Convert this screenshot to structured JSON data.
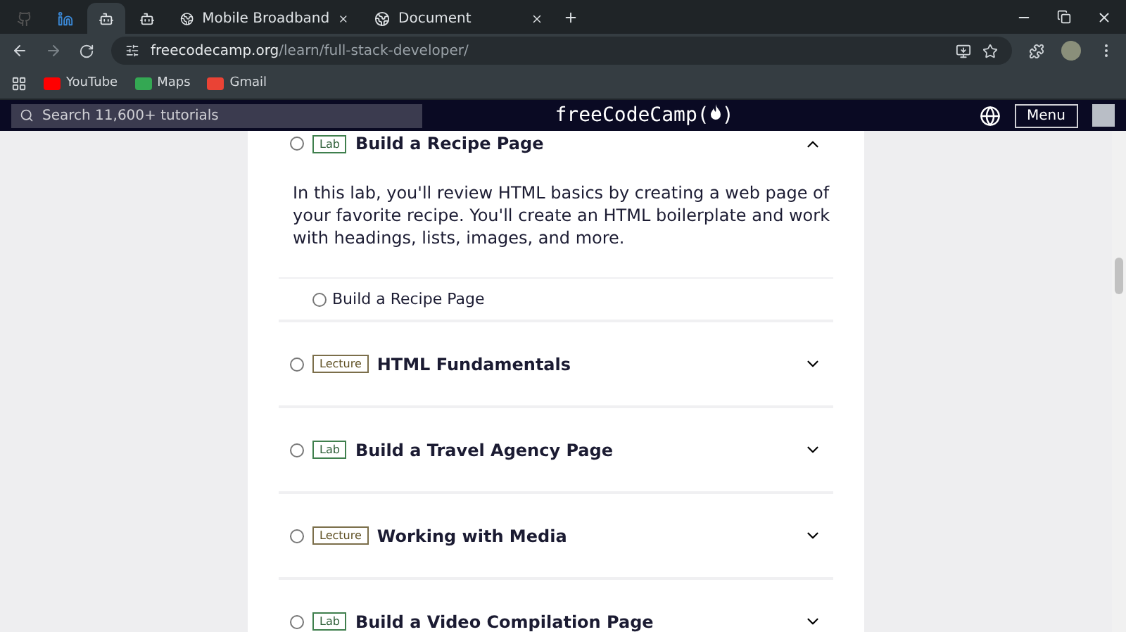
{
  "browser": {
    "tabs": [
      {
        "kind": "github",
        "selected": false
      },
      {
        "kind": "linkedin",
        "selected": false
      },
      {
        "kind": "fcc",
        "selected": true
      },
      {
        "kind": "bot",
        "selected": false
      },
      {
        "kind": "titled",
        "title": "Mobile Broadband",
        "selected": false
      },
      {
        "kind": "titled",
        "title": "Document",
        "selected": false
      }
    ],
    "url": {
      "host": "freecodecamp.org",
      "path": "/learn/full-stack-developer/"
    },
    "bookmarks": [
      {
        "kind": "youtube",
        "label": "YouTube"
      },
      {
        "kind": "maps",
        "label": "Maps"
      },
      {
        "kind": "gmail",
        "label": "Gmail"
      }
    ]
  },
  "navbar": {
    "search": {
      "placeholder": "Search 11,600+ tutorials"
    },
    "logo": "freeCodeCamp(",
    "logo_end": ")",
    "menu": "Menu"
  },
  "blocks": [
    {
      "tag": "Lab",
      "kind": "lab",
      "title": "Build a Recipe Page",
      "expanded": true,
      "completed": false,
      "description": "In this lab, you'll review HTML basics by creating a web page of your favorite recipe. You'll create an HTML boilerplate and work with headings, lists, images, and more.",
      "steps": [
        {
          "label": "Build a Recipe Page",
          "completed": false
        }
      ]
    },
    {
      "tag": "Lecture",
      "kind": "lecture",
      "title": "HTML Fundamentals",
      "expanded": false,
      "completed": false
    },
    {
      "tag": "Lab",
      "kind": "lab",
      "title": "Build a Travel Agency Page",
      "expanded": false,
      "completed": false
    },
    {
      "tag": "Lecture",
      "kind": "lecture",
      "title": "Working with Media",
      "expanded": false,
      "completed": false
    },
    {
      "tag": "Lab",
      "kind": "lab",
      "title": "Build a Video Compilation Page",
      "expanded": false,
      "completed": false
    }
  ]
}
